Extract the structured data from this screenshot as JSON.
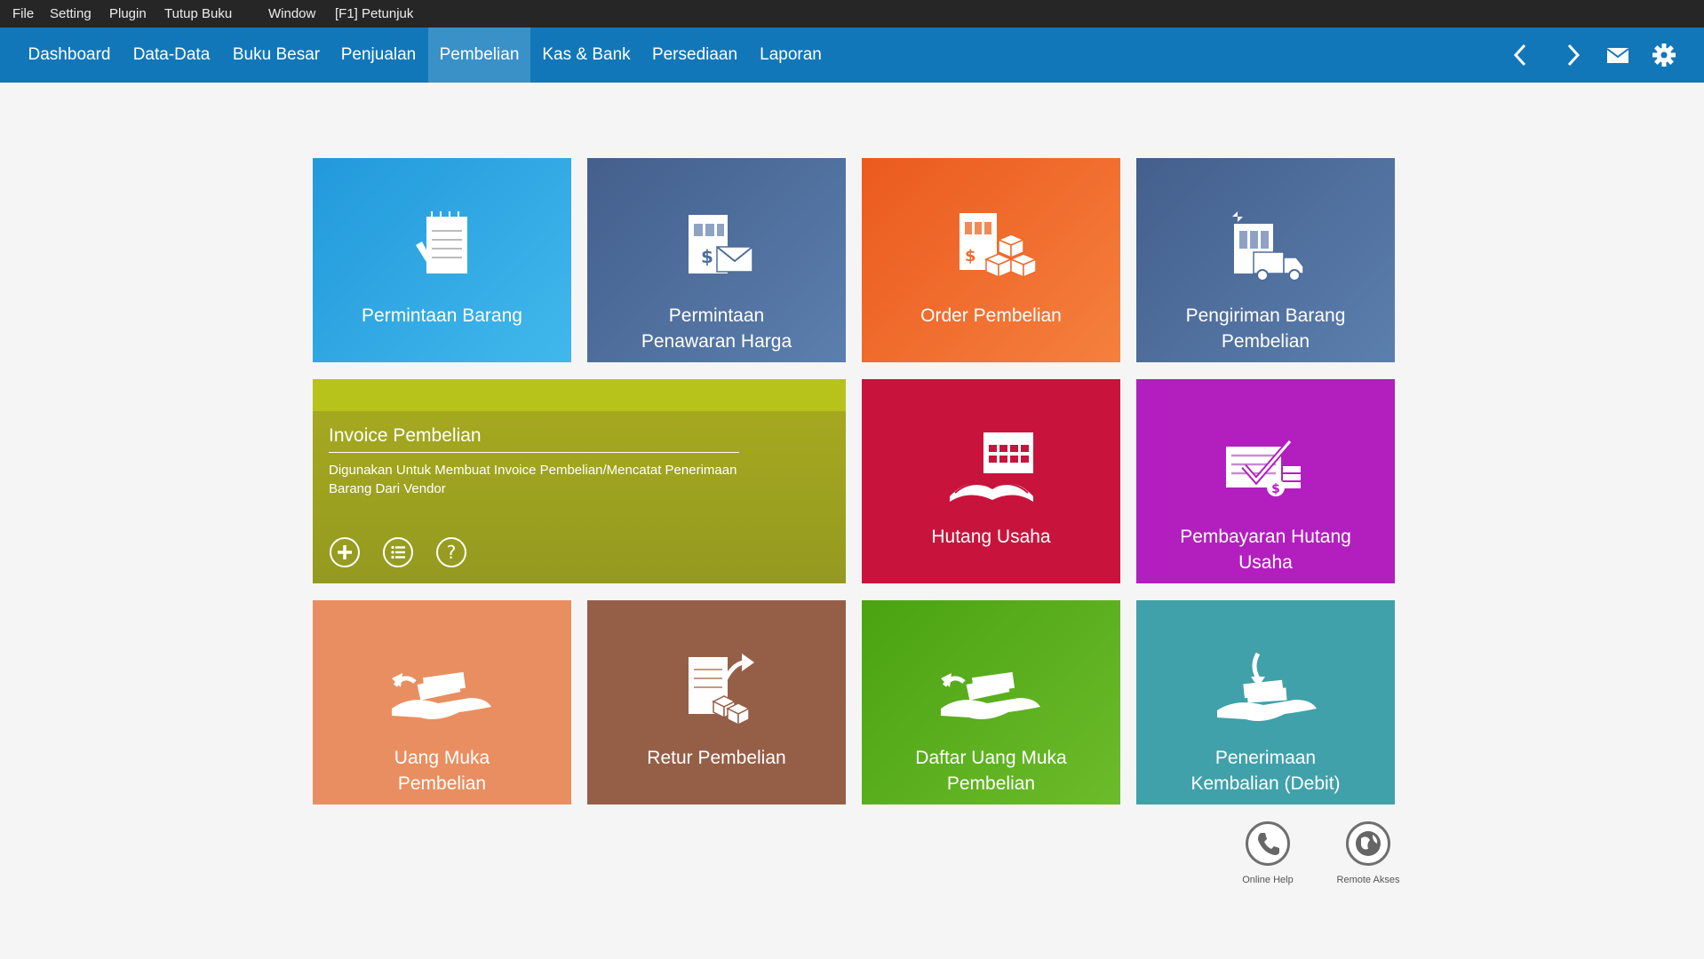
{
  "menubar": {
    "file": "File",
    "setting": "Setting",
    "plugin": "Plugin",
    "tutup_buku": "Tutup Buku",
    "window": "Window",
    "help": "[F1] Petunjuk"
  },
  "nav": {
    "dashboard": "Dashboard",
    "data": "Data-Data",
    "buku_besar": "Buku Besar",
    "penjualan": "Penjualan",
    "pembelian": "Pembelian",
    "kas_bank": "Kas & Bank",
    "persediaan": "Persediaan",
    "laporan": "Laporan",
    "active": "Pembelian"
  },
  "tiles": {
    "permintaan_barang": "Permintaan Barang",
    "permintaan_penawaran": "Permintaan\nPenawaran Harga",
    "order_pembelian": "Order Pembelian",
    "pengiriman_barang": "Pengiriman Barang\nPembelian",
    "hutang_usaha": "Hutang Usaha",
    "pembayaran_hutang": "Pembayaran Hutang\nUsaha",
    "uang_muka": "Uang Muka\nPembelian",
    "retur": "Retur Pembelian",
    "daftar_uang_muka": "Daftar Uang Muka\nPembelian",
    "penerimaan_kembalian": "Penerimaan\nKembalian (Debit)"
  },
  "invoice": {
    "title": "Invoice Pembelian",
    "description": "Digunakan Untuk Membuat Invoice Pembelian/Mencatat Penerimaan Barang Dari Vendor"
  },
  "help": {
    "online": "Online Help",
    "remote": "Remote Akses"
  },
  "colors": {
    "menubar": "#262626",
    "navbar": "#1277b8",
    "nav_active": "#3a91c8",
    "blue_light": "#2ea4e2",
    "slate": "#4f6d9a",
    "orange": "#f06a2b",
    "olive": "#a0a31f",
    "crimson": "#c8143c",
    "magenta": "#b31fbf",
    "salmon": "#e98e60",
    "brown": "#955f47",
    "green": "#5ea91c",
    "teal": "#40a1aa"
  }
}
